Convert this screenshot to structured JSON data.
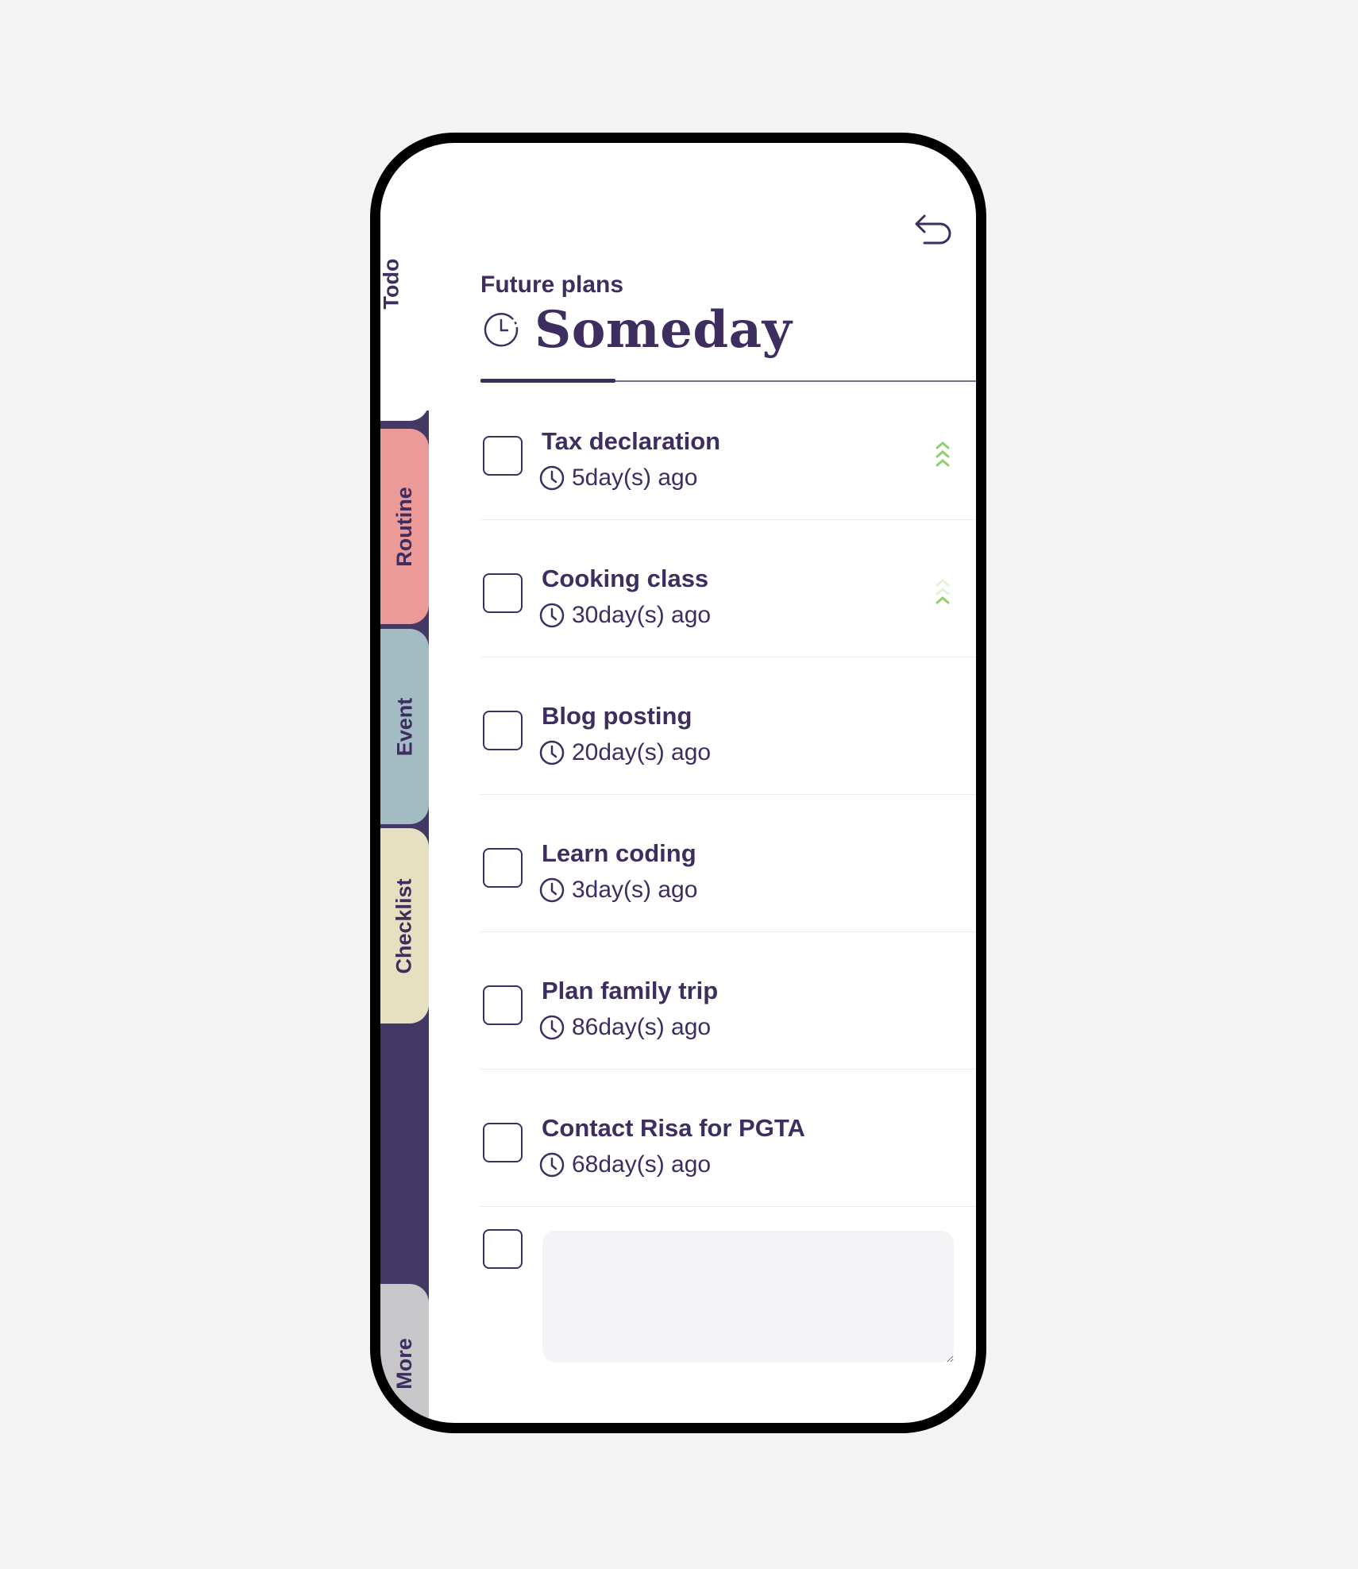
{
  "tabs": [
    {
      "label": "Todo",
      "active": true,
      "color": "#ffffff"
    },
    {
      "label": "Routine",
      "color": "#eb9a98"
    },
    {
      "label": "Event",
      "color": "#a3bcc3"
    },
    {
      "label": "Checklist",
      "color": "#e7e0c0"
    },
    {
      "label": "More",
      "color": "#c7c6c8"
    }
  ],
  "header": {
    "subtitle": "Future plans",
    "title": "Someday",
    "title_icon": "clock-dashed-icon",
    "back_icon": "undo-arrow-icon"
  },
  "items": [
    {
      "title": "Tax declaration",
      "time": "5day(s) ago",
      "priority": "high"
    },
    {
      "title": "Cooking class",
      "time": "30day(s) ago",
      "priority": "low"
    },
    {
      "title": "Blog posting",
      "time": "20day(s) ago",
      "priority": "none"
    },
    {
      "title": "Learn coding",
      "time": "3day(s) ago",
      "priority": "none"
    },
    {
      "title": "Plan family trip",
      "time": "86day(s) ago",
      "priority": "none"
    },
    {
      "title": "Contact Risa for PGTA",
      "time": "68day(s) ago",
      "priority": "none"
    }
  ],
  "new_item": {
    "placeholder": ""
  },
  "colors": {
    "primary": "#3e2d5f",
    "sidebar": "#433866",
    "priority": "#8fcf6f"
  }
}
